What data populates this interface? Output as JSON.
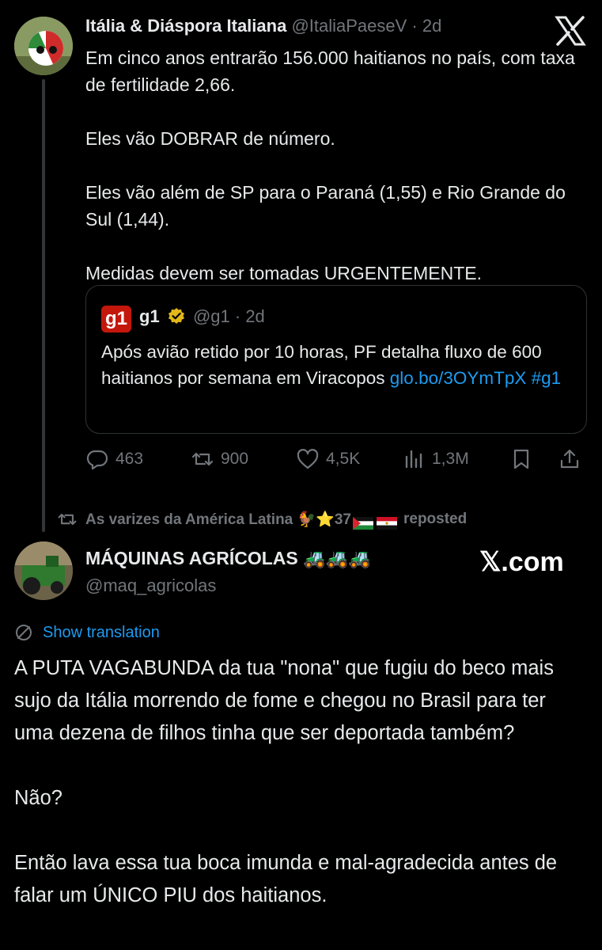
{
  "tweet1": {
    "author_name": "Itália & Diáspora Italiana",
    "author_handle": "@ItaliaPaeseV",
    "time": "· 2d",
    "paragraphs": [
      "Em cinco anos entrarão 156.000 haitianos no país, com taxa de fertilidade 2,66.",
      "Eles vão DOBRAR de número.",
      "Eles vão além de SP para o Paraná (1,55) e Rio Grande do Sul (1,44).",
      "Medidas devem ser tomadas URGENTEMENTE."
    ],
    "quote": {
      "logo_text": "g1",
      "name": "g1",
      "handle": "@g1",
      "time": "· 2d",
      "text": "Após avião retido por 10 horas, PF detalha fluxo de 600 haitianos por semana em Viracopos ",
      "link": "glo.bo/3OYmTpX",
      "hashtag": "#g1"
    },
    "metrics": {
      "replies": "463",
      "reposts": "900",
      "likes": "4,5K",
      "views": "1,3M"
    }
  },
  "repost_banner": {
    "text_before": "As varizes da América Latina 🐓⭐37",
    "text_after": "reposted"
  },
  "tweet2": {
    "author_name": "MÁQUINAS AGRÍCOLAS 🚜🚜🚜",
    "author_handle": "@maq_agricolas",
    "watermark": "𝕏.com",
    "show_translation": "Show translation",
    "paragraphs": [
      "A PUTA VAGABUNDA da tua \"nona\" que fugiu do beco mais sujo da Itália morrendo de fome e chegou no Brasil para ter uma dezena de filhos tinha que ser deportada também?",
      "Não?",
      "Então lava essa tua boca imunda e mal-agradecida antes de falar um ÚNICO PIU dos haitianos."
    ]
  },
  "colors": {
    "background": "#000000",
    "text": "#e7e9ea",
    "muted": "#71767b",
    "link": "#1d9bf0",
    "border": "#2f3336",
    "g1_red": "#c4170c",
    "verified_gold": "#e2b719"
  }
}
